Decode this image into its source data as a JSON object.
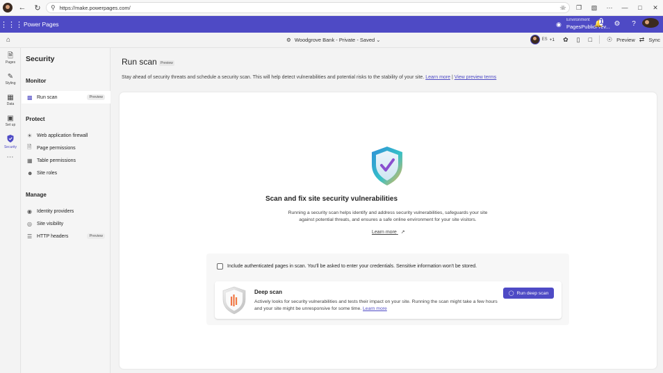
{
  "browser": {
    "url": "https://make.powerpages.com/"
  },
  "header": {
    "app_title": "Power Pages",
    "environment_label": "Environment",
    "environment_value": "PagesPublicPrev...",
    "notification_count": "1"
  },
  "command_bar": {
    "site_name": "Woodgrove Bank - Private - Saved",
    "presence_initials": "ES",
    "presence_more": "+1",
    "preview_label": "Preview",
    "sync_label": "Sync"
  },
  "rail": {
    "items": [
      {
        "label": "",
        "icon": "home-icon"
      },
      {
        "label": "Pages",
        "icon": "pages-icon"
      },
      {
        "label": "Styling",
        "icon": "styling-icon"
      },
      {
        "label": "Data",
        "icon": "data-icon"
      },
      {
        "label": "Set up",
        "icon": "setup-icon"
      },
      {
        "label": "Security",
        "icon": "security-icon"
      }
    ]
  },
  "sidenav": {
    "title": "Security",
    "groups": {
      "monitor": "Monitor",
      "protect": "Protect",
      "manage": "Manage"
    },
    "items": {
      "run_scan": "Run scan",
      "run_scan_badge": "Preview",
      "waf": "Web application firewall",
      "page_permissions": "Page permissions",
      "table_permissions": "Table permissions",
      "site_roles": "Site roles",
      "identity_providers": "Identity providers",
      "site_visibility": "Site visibility",
      "http_headers": "HTTP headers",
      "http_headers_badge": "Preview"
    }
  },
  "main": {
    "title": "Run scan",
    "title_badge": "Preview",
    "description": "Stay ahead of security threats and schedule a security scan. This will help detect vulnerabilities and potential risks to the stability of your site.",
    "desc_link1": "Learn more",
    "desc_sep": "|",
    "desc_link2": "View preview terms",
    "scan_heading": "Scan and fix site security vulnerabilities",
    "scan_sub": "Running a security scan helps identify and address security vulnerabilities, safeguards your site against potential threats, and ensures a safe online environment for your site visitors.",
    "learn_more": "Learn more",
    "checkbox_label": "Include authenticated pages in scan. You'll be asked to enter your credentials. Sensitive information won't be stored.",
    "checkbox_checked": false,
    "deep_scan_title": "Deep scan",
    "deep_scan_desc": "Actively looks for security vulnerabilities and tests their impact on your site. Running the scan might take a few hours and your site might be unresponsive for some time.",
    "deep_scan_link": "Learn more",
    "deep_scan_button": "Run deep scan"
  },
  "colors": {
    "brand": "#4e4ac5",
    "background": "#f3f3f3",
    "card": "#ffffff"
  }
}
